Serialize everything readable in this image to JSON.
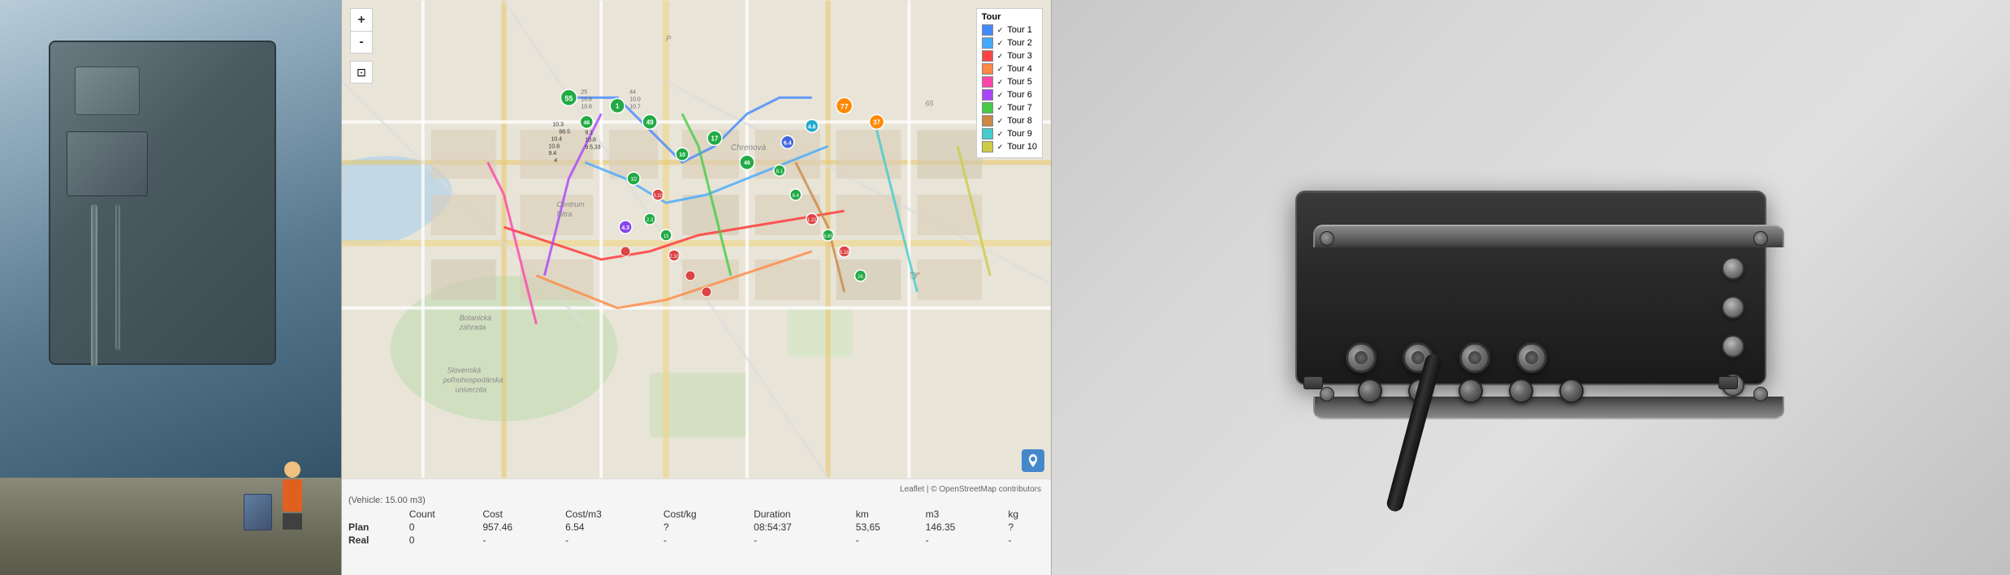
{
  "panels": {
    "truck_photo": {
      "alt": "Garbage truck mechanism from above"
    },
    "map": {
      "controls": {
        "zoom_in": "+",
        "zoom_out": "-"
      },
      "legend": {
        "title": "Tour",
        "items": [
          {
            "label": "Tour 1",
            "color": "#4488ff",
            "checked": true
          },
          {
            "label": "Tour 2",
            "color": "#44aaff",
            "checked": true
          },
          {
            "label": "Tour 3",
            "color": "#ff4444",
            "checked": true
          },
          {
            "label": "Tour 4",
            "color": "#ff8844",
            "checked": true
          },
          {
            "label": "Tour 5",
            "color": "#ff44aa",
            "checked": true
          },
          {
            "label": "Tour 6",
            "color": "#aa44ff",
            "checked": true
          },
          {
            "label": "Tour 7",
            "color": "#44cc44",
            "checked": true
          },
          {
            "label": "Tour 8",
            "color": "#cc8844",
            "checked": true
          },
          {
            "label": "Tour 9",
            "color": "#44cccc",
            "checked": true
          },
          {
            "label": "Tour 10",
            "color": "#cccc44",
            "checked": true
          }
        ]
      },
      "attribution": "Leaflet | © OpenStreetMap contributors",
      "vehicle_label": "(Vehicle: 15.00 m3)",
      "table": {
        "headers": [
          "",
          "Count",
          "Cost",
          "Cost/m3",
          "Cost/kg",
          "Duration",
          "km",
          "m3",
          "kg"
        ],
        "rows": [
          {
            "label": "Plan",
            "count": "0",
            "cost": "957.46",
            "cost_m3": "6.54",
            "cost_kg": "?",
            "duration": "08:54:37",
            "km": "53,65",
            "m3": "146.35",
            "kg": "?"
          },
          {
            "label": "Real",
            "count": "0",
            "cost": "-",
            "cost_m3": "-",
            "cost_kg": "-",
            "duration": "-",
            "km": "-",
            "m3": "-",
            "kg": "-"
          }
        ]
      }
    },
    "device_photo": {
      "alt": "Black electronic device with connectors"
    }
  }
}
